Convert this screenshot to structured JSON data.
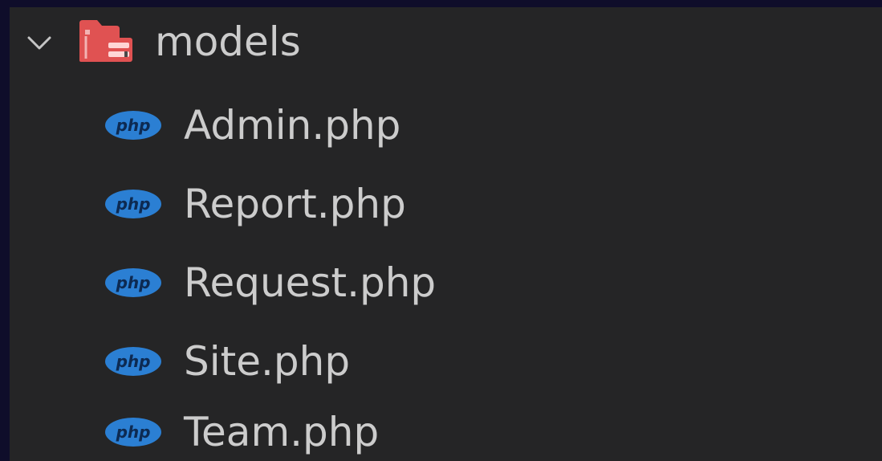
{
  "explorer": {
    "folder": {
      "name": "models",
      "expanded": true,
      "icon": "folder-open-icon",
      "icon_color": "#e05252"
    },
    "files": [
      {
        "name": "Admin.php",
        "icon": "php-icon"
      },
      {
        "name": "Report.php",
        "icon": "php-icon"
      },
      {
        "name": "Request.php",
        "icon": "php-icon"
      },
      {
        "name": "Site.php",
        "icon": "php-icon"
      },
      {
        "name": "Team.php",
        "icon": "php-icon"
      }
    ],
    "php_icon_text": "php",
    "php_icon_color": "#2b7fd3",
    "text_color": "#cccccc",
    "background": "#252526"
  }
}
